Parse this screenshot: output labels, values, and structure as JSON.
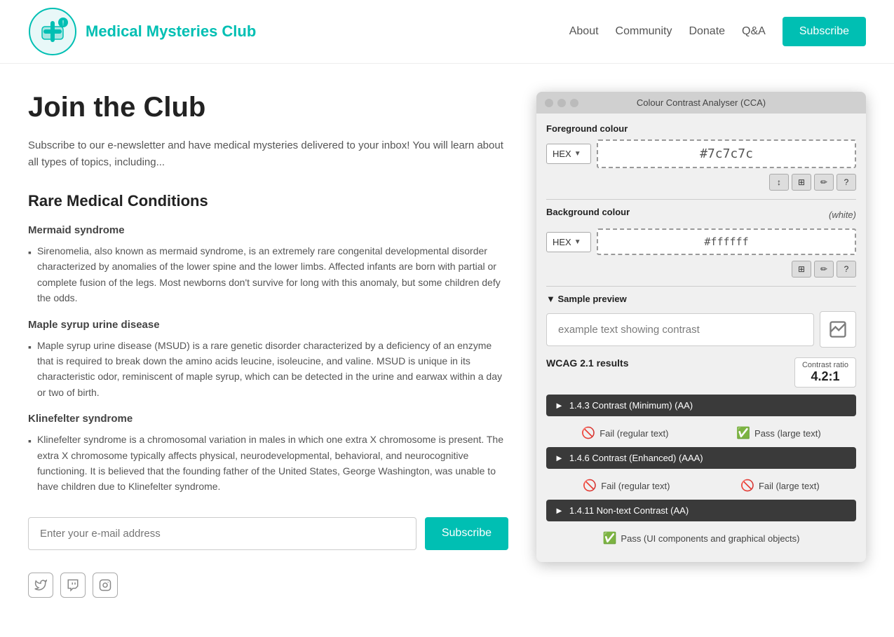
{
  "header": {
    "logo_text": "Medical Mysteries Club",
    "nav_items": [
      {
        "label": "About",
        "href": "#"
      },
      {
        "label": "Community",
        "href": "#"
      },
      {
        "label": "Donate",
        "href": "#"
      },
      {
        "label": "Q&A",
        "href": "#"
      }
    ],
    "subscribe_label": "Subscribe"
  },
  "page": {
    "title": "Join the Club",
    "intro": "Subscribe to our e-newsletter and have medical mysteries delivered to your inbox! You will learn about all types of topics, including...",
    "section_title": "Rare Medical Conditions",
    "conditions": [
      {
        "title": "Mermaid syndrome",
        "items": [
          "Sirenomelia, also known as mermaid syndrome, is an extremely rare congenital developmental disorder characterized by anomalies of the lower spine and the lower limbs. Affected infants are born with partial or complete fusion of the legs. Most newborns don't survive for long with this anomaly, but some children defy the odds."
        ]
      },
      {
        "title": "Maple syrup urine disease",
        "items": [
          "Maple syrup urine disease (MSUD) is a rare genetic disorder characterized by a deficiency of an enzyme that is required to break down the amino acids leucine, isoleucine, and valine. MSUD is unique in its characteristic odor, reminiscent of maple syrup, which can be detected in the urine and earwax within a day or two of birth."
        ]
      },
      {
        "title": "Klinefelter syndrome",
        "items": [
          "Klinefelter syndrome is a chromosomal variation in males in which one extra X chromosome is present. The extra X chromosome typically affects physical, neurodevelopmental, behavioral, and neurocognitive functioning. It is believed that the founding father of the United States, George Washington, was unable to have children due to Klinefelter syndrome."
        ]
      }
    ],
    "email_placeholder": "Enter your e-mail address",
    "form_subscribe_label": "Subscribe"
  },
  "cca": {
    "title": "Colour Contrast Analyser (CCA)",
    "foreground_label": "Foreground colour",
    "foreground_format": "HEX",
    "foreground_value": "#7c7c7c",
    "tool_buttons": [
      "↕",
      "⊞",
      "✏",
      "?"
    ],
    "bg_tool_buttons": [
      "⊞",
      "✏",
      "?"
    ],
    "background_label": "Background colour",
    "background_white_label": "(white)",
    "background_format": "HEX",
    "background_value": "#ffffff",
    "sample_preview_label": "▼ Sample preview",
    "sample_text": "example text showing contrast",
    "chart_icon": "📊",
    "wcag_label": "WCAG 2.1 results",
    "contrast_ratio_label": "Contrast ratio",
    "contrast_ratio_value": "4.2:1",
    "criteria": [
      {
        "label": "► 1.4.3 Contrast (Minimum) (AA)",
        "results": [
          {
            "icon": "fail",
            "text": "Fail (regular text)"
          },
          {
            "icon": "pass",
            "text": "Pass (large text)"
          }
        ]
      },
      {
        "label": "► 1.4.6 Contrast (Enhanced) (AAA)",
        "results": [
          {
            "icon": "fail",
            "text": "Fail (regular text)"
          },
          {
            "icon": "fail",
            "text": "Fail (large text)"
          }
        ]
      },
      {
        "label": "► 1.4.11 Non-text Contrast (AA)",
        "results": [
          {
            "icon": "pass",
            "text": "Pass (UI components and graphical objects)"
          }
        ]
      }
    ]
  }
}
